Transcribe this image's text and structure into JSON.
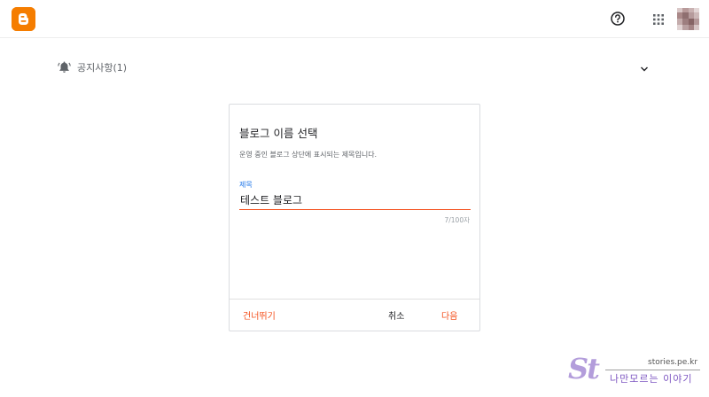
{
  "header": {
    "logo_icon": "blogger-logo",
    "help_icon": "help-icon",
    "apps_icon": "apps-grid-icon",
    "avatar_icon": "user-avatar",
    "brand_color": "#f57d00"
  },
  "notice": {
    "icon": "bell-icon",
    "label": "공지사항(1)",
    "toggle_icon": "chevron-down-icon"
  },
  "dialog": {
    "title": "블로그 이름 선택",
    "description": "운영 중인 블로그 상단에 표시되는 제목입니다.",
    "field_label": "제목",
    "field_value": "테스트 블로그",
    "char_counter": "7/100자",
    "skip_label": "건너뛰기",
    "cancel_label": "취소",
    "next_label": "다음",
    "accent_color": "#f4511e"
  },
  "watermark": {
    "logo_text": "St",
    "url": "stories.pe.kr",
    "tagline": "나만모르는 이야기"
  }
}
